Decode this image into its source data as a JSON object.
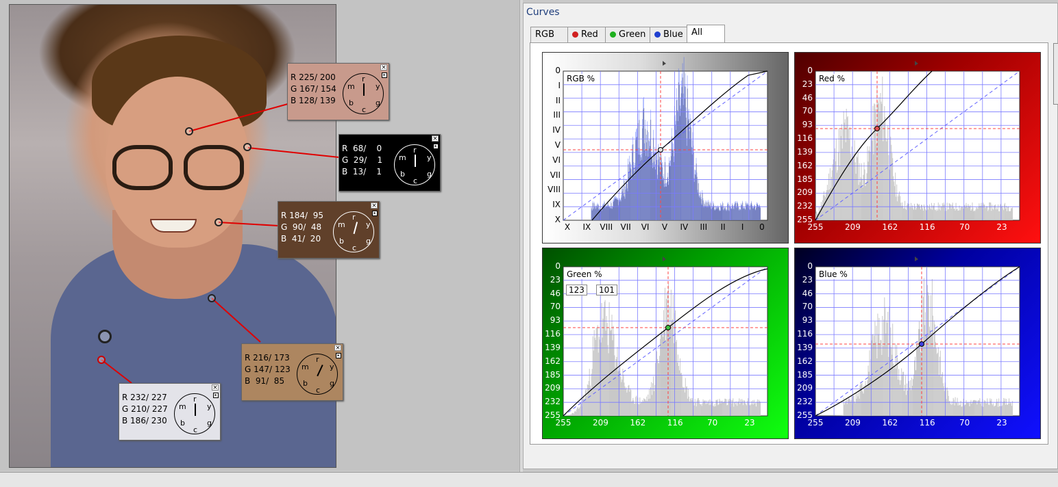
{
  "app": {
    "panel_title": "Curves"
  },
  "tabs": [
    {
      "label": "RGB",
      "dot": ""
    },
    {
      "label": "Red",
      "dot": "#d02020"
    },
    {
      "label": "Green",
      "dot": "#20b020"
    },
    {
      "label": "Blue",
      "dot": "#2040d0"
    },
    {
      "label": "All",
      "dot": "",
      "active": true
    }
  ],
  "probes": [
    {
      "r": "R 225/ 200",
      "g": "G 167/ 154",
      "b": "B 128/ 139",
      "bg": "#c89a8c",
      "text": "#000",
      "dial": [
        "r",
        "y",
        "g",
        "c",
        "b",
        "m"
      ]
    },
    {
      "r": "R  68/    0",
      "g": "G  29/    1",
      "b": "B  13/    1",
      "bg": "#000000",
      "text": "#fff",
      "dial": [
        "r",
        "y",
        "g",
        "c",
        "b",
        "m"
      ]
    },
    {
      "r": "R 184/  95",
      "g": "G  90/  48",
      "b": "B  41/  20",
      "bg": "#60402a",
      "text": "#fff",
      "dial": [
        "r",
        "y",
        "g",
        "c",
        "b",
        "m"
      ]
    },
    {
      "r": "R 216/ 173",
      "g": "G 147/ 123",
      "b": "B  91/  85",
      "bg": "#ad8660",
      "text": "#000",
      "dial": [
        "r",
        "y",
        "g",
        "c",
        "b",
        "m"
      ]
    },
    {
      "r": "R 232/ 227",
      "g": "G 210/ 227",
      "b": "B 186/ 230",
      "bg": "#e3e3e9",
      "text": "#000",
      "dial": [
        "r",
        "y",
        "g",
        "c",
        "b",
        "m"
      ]
    }
  ],
  "graphs": {
    "rgb": {
      "label": "RGB %",
      "y_ticks": [
        "0",
        "I",
        "II",
        "III",
        "IV",
        "V",
        "VI",
        "VII",
        "VIII",
        "IX",
        "X"
      ],
      "x_ticks": [
        "X",
        "IX",
        "VIII",
        "VII",
        "VI",
        "V",
        "IV",
        "III",
        "II",
        "I",
        "0"
      ]
    },
    "red": {
      "label": "Red %",
      "y_ticks": [
        "0",
        "23",
        "46",
        "70",
        "93",
        "116",
        "139",
        "162",
        "185",
        "209",
        "232",
        "255"
      ],
      "x_ticks": [
        "255",
        "209",
        "162",
        "116",
        "70",
        "23"
      ]
    },
    "green": {
      "label": "Green %",
      "input_value": "123",
      "output_value": "101",
      "y_ticks": [
        "0",
        "23",
        "46",
        "70",
        "93",
        "116",
        "139",
        "162",
        "185",
        "209",
        "232",
        "255"
      ],
      "x_ticks": [
        "255",
        "209",
        "162",
        "116",
        "70",
        "23"
      ]
    },
    "blue": {
      "label": "Blue %",
      "y_ticks": [
        "0",
        "23",
        "46",
        "70",
        "93",
        "116",
        "139",
        "162",
        "185",
        "209",
        "232",
        "255"
      ],
      "x_ticks": [
        "255",
        "209",
        "162",
        "116",
        "70",
        "23"
      ]
    }
  },
  "colors": {
    "red_bg": "#a00000",
    "green_bg": "#00a000",
    "blue_bg": "#0000a0",
    "grid": "#7a7aff",
    "curve": "#000000"
  },
  "icons": [
    "close-icon",
    "pin-icon",
    "eyedropper-icon",
    "triangle-marker-icon"
  ]
}
